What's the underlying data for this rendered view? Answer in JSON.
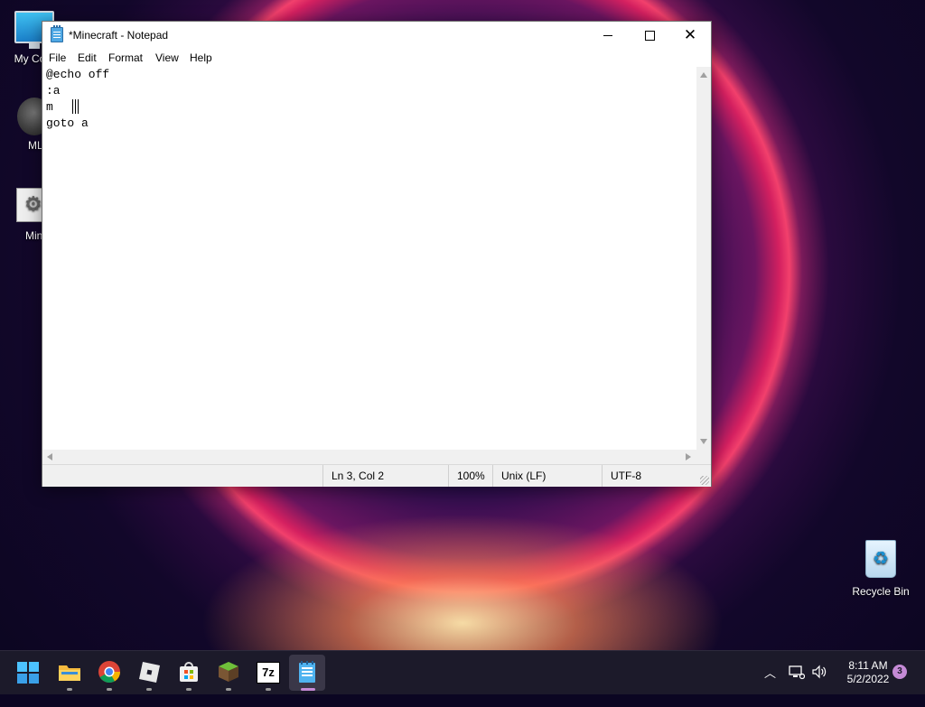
{
  "desktop": {
    "icons": [
      {
        "label": "My Com"
      },
      {
        "label": "MLG"
      },
      {
        "label": "Minec"
      },
      {
        "label": "Recycle Bin"
      }
    ]
  },
  "notepad": {
    "title": "*Minecraft - Notepad",
    "menu": [
      "File",
      "Edit",
      "Format",
      "View",
      "Help"
    ],
    "lines": [
      "@echo off",
      ":a",
      "m",
      "goto a"
    ],
    "status": {
      "position": "Ln 3, Col 2",
      "zoom": "100%",
      "line_ending": "Unix (LF)",
      "encoding": "UTF-8"
    }
  },
  "taskbar": {
    "apps": [
      "start-icon",
      "file-explorer-icon",
      "chrome-icon",
      "roblox-icon",
      "store-icon",
      "minecraft-icon",
      "7zip-icon",
      "notepad-icon"
    ],
    "seven_zip_label": "7z",
    "clock_time": "8:11 AM",
    "clock_date": "5/2/2022",
    "notifications": "3"
  }
}
